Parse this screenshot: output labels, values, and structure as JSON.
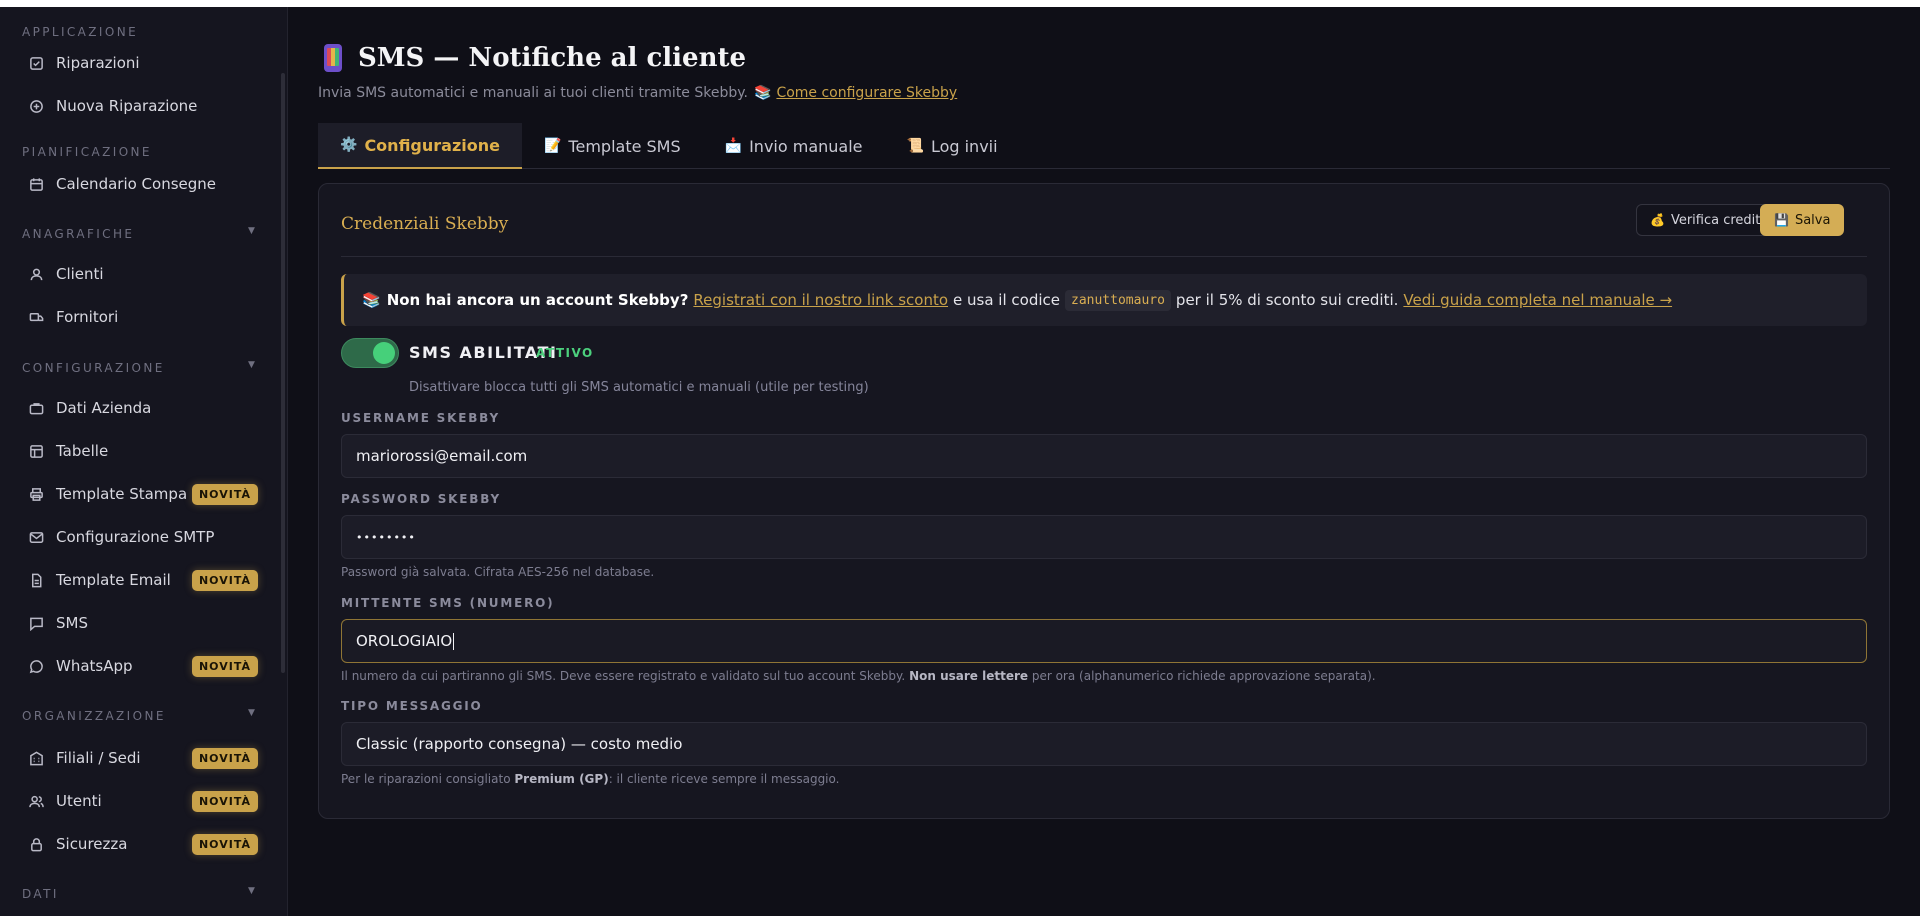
{
  "sidebar": {
    "sections": [
      {
        "title": "APPLICAZIONE",
        "collapsible": false
      },
      {
        "title": "PIANIFICAZIONE",
        "collapsible": false
      },
      {
        "title": "ANAGRAFICHE",
        "collapsible": true
      },
      {
        "title": "CONFIGURAZIONE",
        "collapsible": true
      },
      {
        "title": "ORGANIZZAZIONE",
        "collapsible": true
      },
      {
        "title": "DATI",
        "collapsible": true
      }
    ],
    "items": [
      {
        "label": "Riparazioni",
        "icon": "check-square-icon"
      },
      {
        "label": "Nuova Riparazione",
        "icon": "plus-circle-icon"
      },
      {
        "label": "Calendario Consegne",
        "icon": "calendar-icon"
      },
      {
        "label": "Clienti",
        "icon": "user-icon"
      },
      {
        "label": "Fornitori",
        "icon": "truck-icon"
      },
      {
        "label": "Dati Azienda",
        "icon": "briefcase-icon"
      },
      {
        "label": "Tabelle",
        "icon": "table-icon"
      },
      {
        "label": "Template Stampa",
        "icon": "printer-icon",
        "badge": "NOVITÀ"
      },
      {
        "label": "Configurazione SMTP",
        "icon": "mail-icon"
      },
      {
        "label": "Template Email",
        "icon": "file-icon",
        "badge": "NOVITÀ"
      },
      {
        "label": "SMS",
        "icon": "message-square-icon"
      },
      {
        "label": "WhatsApp",
        "icon": "message-circle-icon",
        "badge": "NOVITÀ"
      },
      {
        "label": "Filiali / Sedi",
        "icon": "building-icon",
        "badge": "NOVITÀ"
      },
      {
        "label": "Utenti",
        "icon": "users-icon",
        "badge": "NOVITÀ"
      },
      {
        "label": "Sicurezza",
        "icon": "lock-icon",
        "badge": "NOVITÀ"
      }
    ]
  },
  "page": {
    "title": "SMS — Notifiche al cliente",
    "title_icon": "mobile-phone-icon",
    "subtitle": "Invia SMS automatici e manuali ai tuoi clienti tramite Skebby.",
    "subtitle_link": "Come configurare Skebby"
  },
  "tabs": [
    {
      "label": "Configurazione",
      "icon": "⚙️",
      "active": true
    },
    {
      "label": "Template SMS",
      "icon": "📝",
      "active": false
    },
    {
      "label": "Invio manuale",
      "icon": "📩",
      "active": false
    },
    {
      "label": "Log invii",
      "icon": "📜",
      "active": false
    }
  ],
  "card": {
    "title": "Credenziali Skebby",
    "verify_button": "Verifica credito",
    "save_button": "Salva"
  },
  "notice": {
    "bold": "Non hai ancora un account Skebby?",
    "link": "Registrati con il nostro link sconto",
    "text1": "e usa il codice",
    "code": "zanuttomauro",
    "text2": "per il 5% di sconto sui crediti.",
    "guide_link": "Vedi guida completa nel manuale →"
  },
  "toggle": {
    "label": "SMS ABILITATI",
    "status": "ATTIVO",
    "help": "Disattivare blocca tutti gli SMS automatici e manuali (utile per testing)"
  },
  "fields": {
    "username": {
      "label": "USERNAME SKEBBY",
      "value": "mariorossi@email.com"
    },
    "password": {
      "label": "PASSWORD SKEBBY",
      "value": "••••••••",
      "help": "Password già salvata. Cifrata AES-256 nel database."
    },
    "sender": {
      "label": "MITTENTE SMS (NUMERO)",
      "value": "OROLOGIAIO",
      "help1": "Il numero da cui partiranno gli SMS. Deve essere registrato e validato sul tuo account Skebby.",
      "help_bold": "Non usare lettere",
      "help2": "per ora (alphanumerico richiede approvazione separata)."
    },
    "type": {
      "label": "TIPO MESSAGGIO",
      "value": "Classic (rapporto consegna) — costo medio",
      "help1": "Per le riparazioni consigliato",
      "help_bold": "Premium (GP)",
      "help2": ": il cliente riceve sempre il messaggio."
    }
  },
  "colors": {
    "accent": "#c9a24a",
    "active_green": "#46d07a",
    "background": "#0f0f17"
  }
}
